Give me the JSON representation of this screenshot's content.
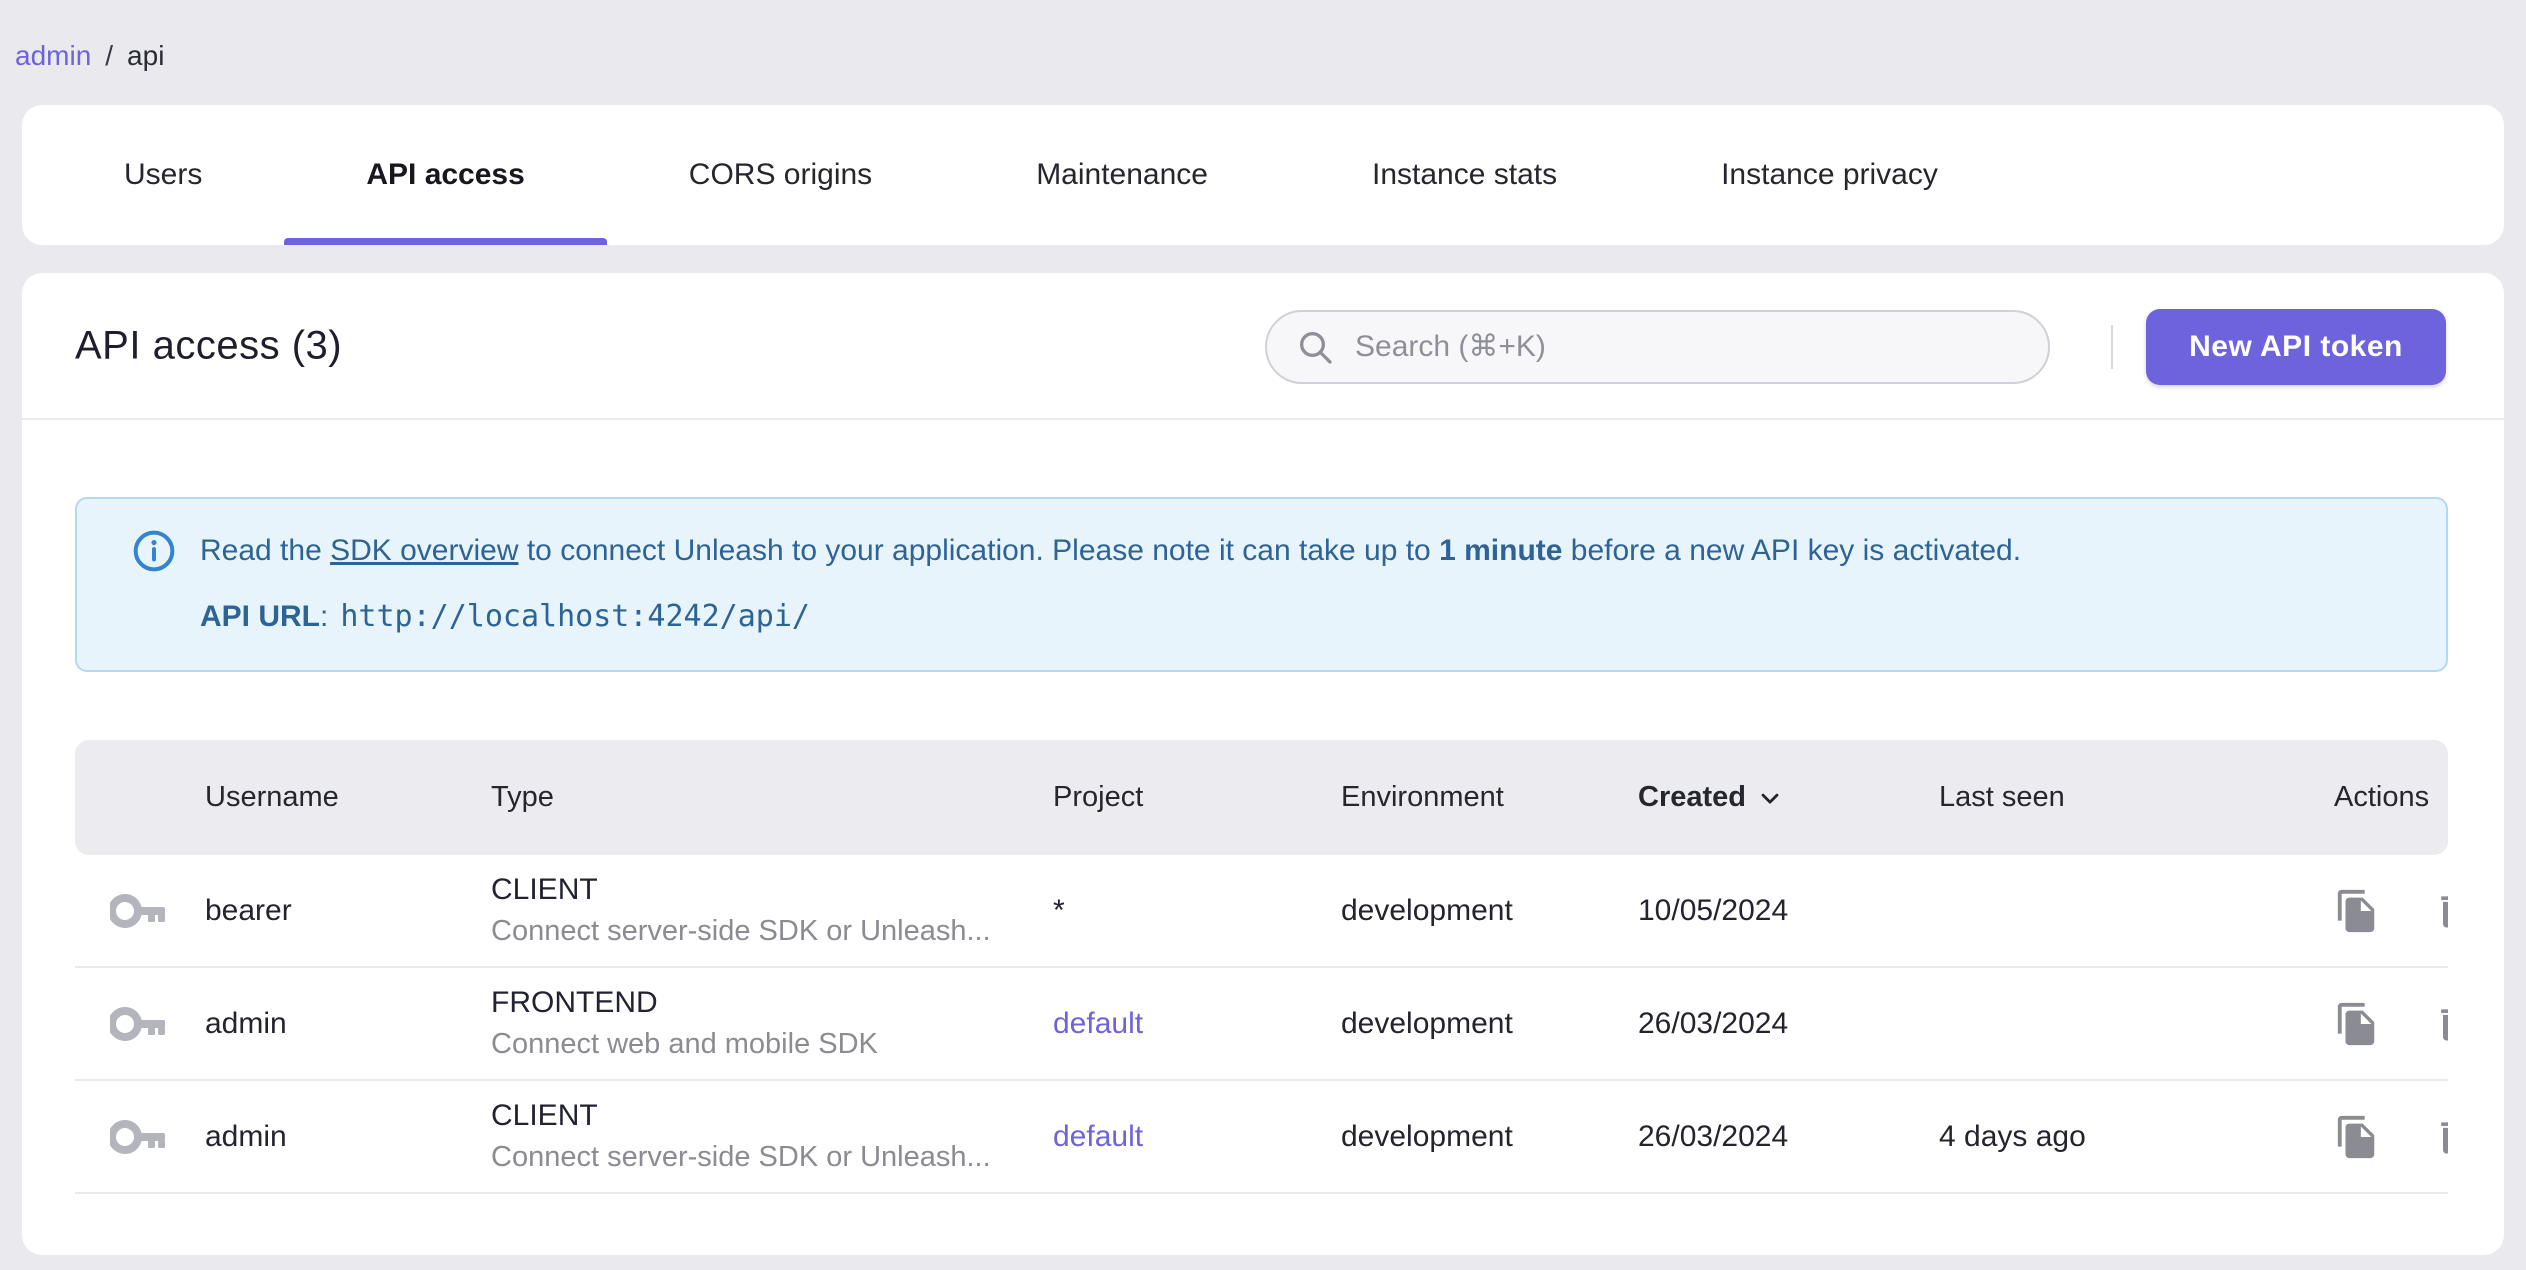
{
  "breadcrumb": {
    "items": [
      {
        "label": "admin"
      },
      {
        "label": "api"
      }
    ],
    "separator": "/"
  },
  "tabs": {
    "items": [
      {
        "label": "Users",
        "active": false
      },
      {
        "label": "API access",
        "active": true
      },
      {
        "label": "CORS origins",
        "active": false
      },
      {
        "label": "Maintenance",
        "active": false
      },
      {
        "label": "Instance stats",
        "active": false
      },
      {
        "label": "Instance privacy",
        "active": false
      }
    ]
  },
  "header": {
    "title": "API access (3)",
    "search_placeholder": "Search (⌘+K)",
    "new_token_label": "New API token"
  },
  "banner": {
    "text_prefix": "Read the ",
    "link": "SDK overview",
    "text_mid": " to connect Unleash to your application. Please note it can take up to ",
    "bold": "1 minute",
    "text_suffix": " before a new API key is activated.",
    "api_url_label": "API URL",
    "api_url_separator": ":",
    "api_url": "http://localhost:4242/api/"
  },
  "table": {
    "columns": [
      "Username",
      "Type",
      "Project",
      "Environment",
      "Created",
      "Last seen",
      "Actions"
    ],
    "sorted_column": "Created",
    "sort_direction": "desc",
    "rows": [
      {
        "username": "bearer",
        "type": "CLIENT",
        "type_description": "Connect server-side SDK or Unleash...",
        "project": "*",
        "environment": "development",
        "created": "10/05/2024",
        "last_seen": ""
      },
      {
        "username": "admin",
        "type": "FRONTEND",
        "type_description": "Connect web and mobile SDK",
        "project": "default",
        "environment": "development",
        "created": "26/03/2024",
        "last_seen": ""
      },
      {
        "username": "admin",
        "type": "CLIENT",
        "type_description": "Connect server-side SDK or Unleash...",
        "project": "default",
        "environment": "development",
        "created": "26/03/2024",
        "last_seen": "4 days ago"
      }
    ]
  },
  "colors": {
    "primary": "#6c63dd",
    "page_background": "#e9e9ee",
    "banner_background": "#e8f4fb",
    "banner_border": "#b3d9f0",
    "banner_text": "#2d6395",
    "table_header_background": "#ebebf0",
    "muted_text": "#8b8b93"
  }
}
